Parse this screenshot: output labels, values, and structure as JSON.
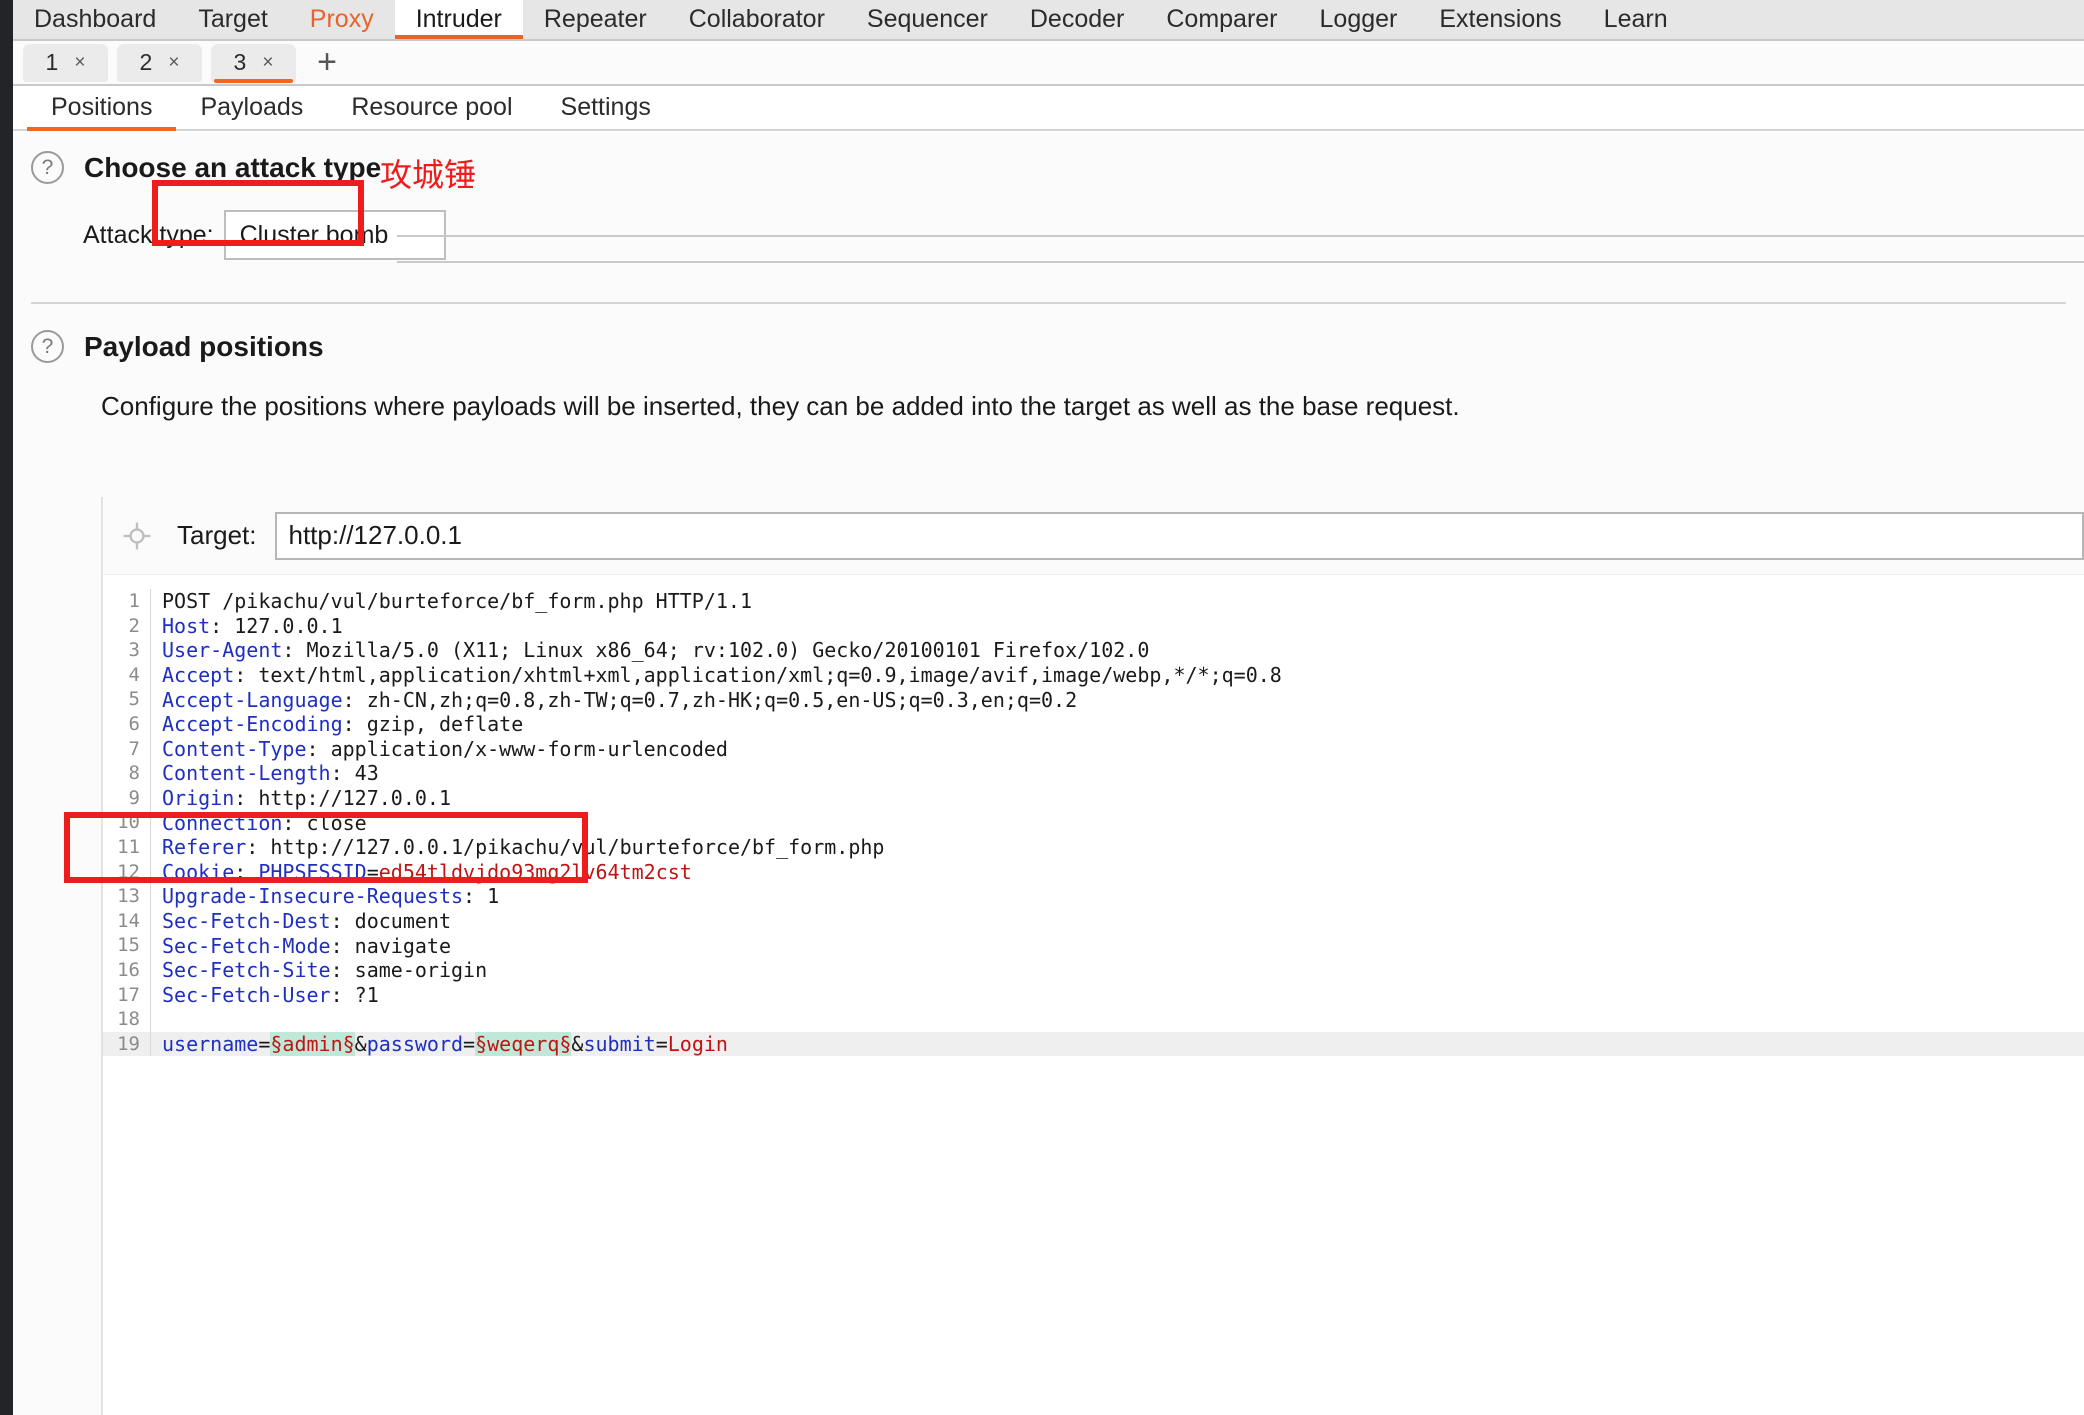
{
  "menubar": {
    "items": [
      {
        "label": "Dashboard",
        "state": "normal"
      },
      {
        "label": "Target",
        "state": "normal"
      },
      {
        "label": "Proxy",
        "state": "proxy"
      },
      {
        "label": "Intruder",
        "state": "active"
      },
      {
        "label": "Repeater",
        "state": "normal"
      },
      {
        "label": "Collaborator",
        "state": "normal"
      },
      {
        "label": "Sequencer",
        "state": "normal"
      },
      {
        "label": "Decoder",
        "state": "normal"
      },
      {
        "label": "Comparer",
        "state": "normal"
      },
      {
        "label": "Logger",
        "state": "normal"
      },
      {
        "label": "Extensions",
        "state": "normal"
      },
      {
        "label": "Learn",
        "state": "normal"
      }
    ]
  },
  "attack_tabs": {
    "items": [
      {
        "label": "1",
        "close": "×",
        "active": false
      },
      {
        "label": "2",
        "close": "×",
        "active": false
      },
      {
        "label": "3",
        "close": "×",
        "active": true
      }
    ],
    "add_label": "+"
  },
  "sub_tabs": {
    "items": [
      {
        "label": "Positions",
        "active": true
      },
      {
        "label": "Payloads",
        "active": false
      },
      {
        "label": "Resource pool",
        "active": false
      },
      {
        "label": "Settings",
        "active": false
      }
    ]
  },
  "attack_type_section": {
    "help_icon": "?",
    "title": "Choose an attack type",
    "field_label": "Attack type:",
    "selected_value": "Cluster bomb",
    "annotation": "攻城锤",
    "annotation_color": "#ee1c1c",
    "highlight_color": "#ee1c1c"
  },
  "payload_positions_section": {
    "help_icon": "?",
    "title": "Payload positions",
    "description": "Configure the positions where payloads will be inserted, they can be added into the target as well as the base request."
  },
  "target": {
    "icon": "crosshair-icon",
    "label": "Target:",
    "value": "http://127.0.0.1"
  },
  "request": {
    "lines": [
      {
        "n": "1",
        "parts": [
          {
            "t": "POST /pikachu/vul/burteforce/bf_form.php HTTP/1.1",
            "c": "val"
          }
        ]
      },
      {
        "n": "2",
        "parts": [
          {
            "t": "Host",
            "c": "hdr"
          },
          {
            "t": ": 127.0.0.1",
            "c": "val"
          }
        ]
      },
      {
        "n": "3",
        "parts": [
          {
            "t": "User-Agent",
            "c": "hdr"
          },
          {
            "t": ": Mozilla/5.0 (X11; Linux x86_64; rv:102.0) Gecko/20100101 Firefox/102.0",
            "c": "val"
          }
        ]
      },
      {
        "n": "4",
        "parts": [
          {
            "t": "Accept",
            "c": "hdr"
          },
          {
            "t": ": text/html,application/xhtml+xml,application/xml;q=0.9,image/avif,image/webp,*/*;q=0.8",
            "c": "val"
          }
        ]
      },
      {
        "n": "5",
        "parts": [
          {
            "t": "Accept-Language",
            "c": "hdr"
          },
          {
            "t": ": zh-CN,zh;q=0.8,zh-TW;q=0.7,zh-HK;q=0.5,en-US;q=0.3,en;q=0.2",
            "c": "val"
          }
        ]
      },
      {
        "n": "6",
        "parts": [
          {
            "t": "Accept-Encoding",
            "c": "hdr"
          },
          {
            "t": ": gzip, deflate",
            "c": "val"
          }
        ]
      },
      {
        "n": "7",
        "parts": [
          {
            "t": "Content-Type",
            "c": "hdr"
          },
          {
            "t": ": application/x-www-form-urlencoded",
            "c": "val"
          }
        ]
      },
      {
        "n": "8",
        "parts": [
          {
            "t": "Content-Length",
            "c": "hdr"
          },
          {
            "t": ": 43",
            "c": "val"
          }
        ]
      },
      {
        "n": "9",
        "parts": [
          {
            "t": "Origin",
            "c": "hdr"
          },
          {
            "t": ": http://127.0.0.1",
            "c": "val"
          }
        ]
      },
      {
        "n": "10",
        "parts": [
          {
            "t": "Connection",
            "c": "hdr"
          },
          {
            "t": ": close",
            "c": "val"
          }
        ]
      },
      {
        "n": "11",
        "parts": [
          {
            "t": "Referer",
            "c": "hdr"
          },
          {
            "t": ": http://127.0.0.1/pikachu/vul/burteforce/bf_form.php",
            "c": "val"
          }
        ]
      },
      {
        "n": "12",
        "parts": [
          {
            "t": "Cookie",
            "c": "hdr"
          },
          {
            "t": ": ",
            "c": "val"
          },
          {
            "t": "PHPSESSID",
            "c": "hdr"
          },
          {
            "t": "=",
            "c": "val"
          },
          {
            "t": "ed54tldvjdo93mg2lv64tm2cst",
            "c": "red"
          }
        ]
      },
      {
        "n": "13",
        "parts": [
          {
            "t": "Upgrade-Insecure-Requests",
            "c": "hdr"
          },
          {
            "t": ": 1",
            "c": "val"
          }
        ]
      },
      {
        "n": "14",
        "parts": [
          {
            "t": "Sec-Fetch-Dest",
            "c": "hdr"
          },
          {
            "t": ": document",
            "c": "val"
          }
        ]
      },
      {
        "n": "15",
        "parts": [
          {
            "t": "Sec-Fetch-Mode",
            "c": "hdr"
          },
          {
            "t": ": navigate",
            "c": "val"
          }
        ]
      },
      {
        "n": "16",
        "parts": [
          {
            "t": "Sec-Fetch-Site",
            "c": "hdr"
          },
          {
            "t": ": same-origin",
            "c": "val"
          }
        ]
      },
      {
        "n": "17",
        "parts": [
          {
            "t": "Sec-Fetch-User",
            "c": "hdr"
          },
          {
            "t": ": ?1",
            "c": "val"
          }
        ]
      },
      {
        "n": "18",
        "parts": []
      },
      {
        "n": "19",
        "highlight": true,
        "parts": [
          {
            "t": "username",
            "c": "pmn"
          },
          {
            "t": "=",
            "c": "val"
          },
          {
            "t": "§admin§",
            "c": "pm"
          },
          {
            "t": "&",
            "c": "val"
          },
          {
            "t": "password",
            "c": "pmn"
          },
          {
            "t": "=",
            "c": "val"
          },
          {
            "t": "§weqerq§",
            "c": "pm"
          },
          {
            "t": "&",
            "c": "val"
          },
          {
            "t": "submit",
            "c": "pmn"
          },
          {
            "t": "=",
            "c": "val"
          },
          {
            "t": "Login",
            "c": "red"
          }
        ]
      }
    ]
  }
}
